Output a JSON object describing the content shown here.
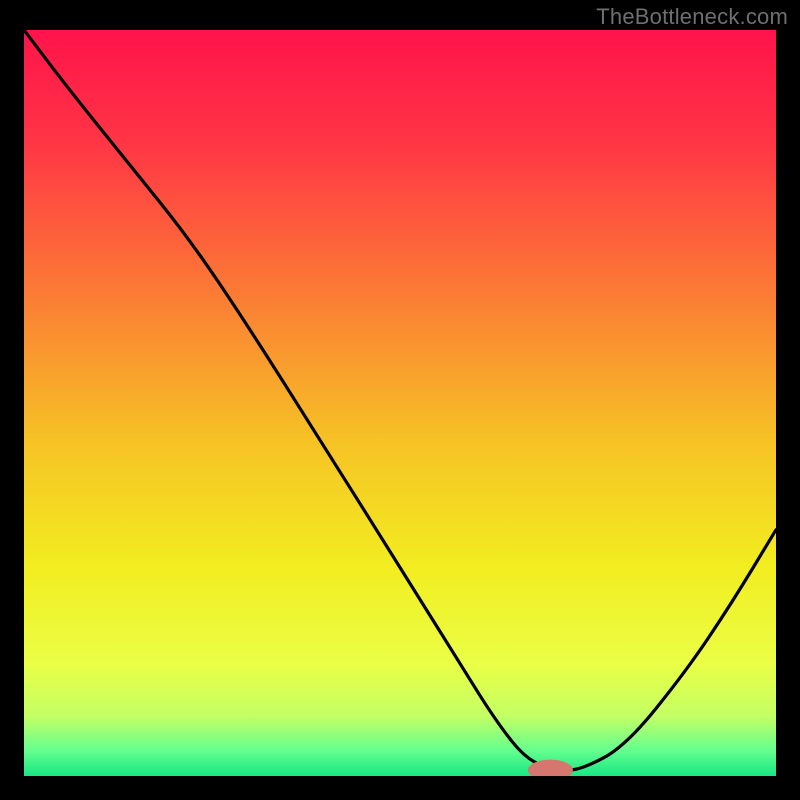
{
  "watermark": "TheBottleneck.com",
  "colors": {
    "bg_black": "#000000",
    "watermark_gray": "#6f6f6f",
    "curve": "#000000",
    "marker": "#d6766e",
    "gradient_stops": [
      {
        "offset": 0.0,
        "color": "#ff134b"
      },
      {
        "offset": 0.15,
        "color": "#ff3545"
      },
      {
        "offset": 0.35,
        "color": "#fb7a35"
      },
      {
        "offset": 0.55,
        "color": "#f6c225"
      },
      {
        "offset": 0.72,
        "color": "#f2ed20"
      },
      {
        "offset": 0.85,
        "color": "#eaff46"
      },
      {
        "offset": 0.92,
        "color": "#c3ff64"
      },
      {
        "offset": 0.965,
        "color": "#66ff8e"
      },
      {
        "offset": 1.0,
        "color": "#17e884"
      }
    ]
  },
  "chart_data": {
    "type": "line",
    "title": "",
    "xlabel": "",
    "ylabel": "",
    "xlim": [
      0,
      100
    ],
    "ylim": [
      0,
      100
    ],
    "grid": false,
    "legend": false,
    "series": [
      {
        "name": "bottleneck-curve",
        "x": [
          0.0,
          6.0,
          14.0,
          22.0,
          30.0,
          40.0,
          50.0,
          58.0,
          63.0,
          67.0,
          71.0,
          74.0,
          80.0,
          88.0,
          94.0,
          100.0
        ],
        "y": [
          100.0,
          92.0,
          82.0,
          72.0,
          60.0,
          44.0,
          28.0,
          15.0,
          7.0,
          2.0,
          0.8,
          0.8,
          4.0,
          14.0,
          23.0,
          33.0
        ]
      }
    ],
    "marker": {
      "x": 70.0,
      "y": 0.8,
      "rx": 3.0,
      "ry": 1.4
    },
    "notes": "Background is a vertical red→yellow→green gradient on black frame; a single black V-shaped curve with minimum near x≈70; small salmon pill marker at the minimum."
  }
}
